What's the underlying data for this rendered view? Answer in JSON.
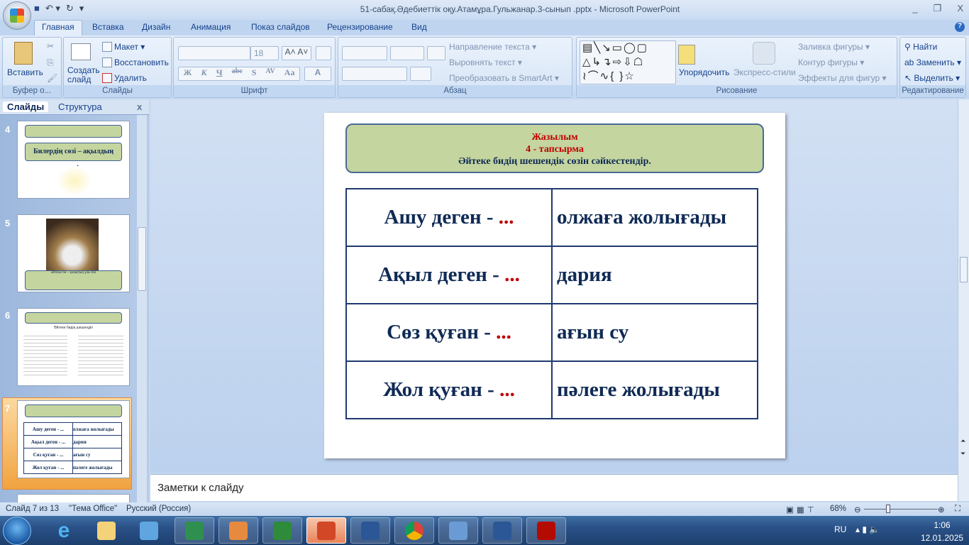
{
  "window": {
    "title": "51-сабақ.Әдебиеттік оқу.Атамұра.Гульжанар.3-сынып .pptx - Microsoft PowerPoint",
    "minimize": "_",
    "restore": "❐",
    "close": "X",
    "help": "?"
  },
  "tabs": [
    "Главная",
    "Вставка",
    "Дизайн",
    "Анимация",
    "Показ слайдов",
    "Рецензирование",
    "Вид"
  ],
  "ribbon": {
    "clipboard": {
      "label": "Буфер о...",
      "paste": "Вставить"
    },
    "slides": {
      "label": "Слайды",
      "new_slide": "Создать слайд",
      "layout": "Макет",
      "reset": "Восстановить",
      "delete": "Удалить"
    },
    "font": {
      "label": "Шрифт",
      "size": "18",
      "bold": "Ж",
      "italic": "К",
      "underline": "Ч",
      "strike": "abc",
      "shadow": "S",
      "spacing": "AV",
      "case": "Aa",
      "color": "A"
    },
    "paragraph": {
      "label": "Абзац",
      "direction": "Направление текста",
      "align": "Выровнять текст",
      "smartart": "Преобразовать в SmartArt"
    },
    "drawing": {
      "label": "Рисование",
      "arrange": "Упорядочить",
      "quick_styles": "Экспресс-стили",
      "fill": "Заливка фигуры",
      "outline": "Контур фигуры",
      "effects": "Эффекты для фигур"
    },
    "editing": {
      "label": "Редактирование",
      "find": "Найти",
      "replace": "Заменить",
      "select": "Выделить"
    }
  },
  "left_pane": {
    "tabs": [
      "Слайды",
      "Структура"
    ],
    "close": "x",
    "thumbs": [
      {
        "num": "4",
        "title": "Билердің сөзі – ақылдың көзі."
      },
      {
        "num": "5",
        "caption": "Әйтеке би – қазақтың ұлы биі"
      },
      {
        "num": "6",
        "caption": "Әйтеке бидің шешендігі"
      },
      {
        "num": "7",
        "rows": [
          [
            "Ашу деген - ...",
            "олжаға жолығады"
          ],
          [
            "Ақыл деген - ...",
            "дария"
          ],
          [
            "Сөз қуған - ...",
            "ағын су"
          ],
          [
            "Жол қуған - ...",
            "пәлеге жолығады"
          ]
        ]
      }
    ]
  },
  "slide": {
    "heading1": "Жазылым",
    "heading2": "4 - тапсырма",
    "instruction": "Әйтеке бидің шешендік  сөзін  сәйкестендір.",
    "table": [
      {
        "left": "Ашу деген - ",
        "dots": "...",
        "right": "олжаға жолығады"
      },
      {
        "left": "Ақыл деген - ",
        "dots": "...",
        "right": "дария"
      },
      {
        "left": "Сөз қуған - ",
        "dots": "...",
        "right": "ағын су"
      },
      {
        "left": "Жол қуған - ",
        "dots": "...",
        "right": "пәлеге жолығады"
      }
    ]
  },
  "notes_placeholder": "Заметки к слайду",
  "status": {
    "slide": "Слайд 7 из 13",
    "theme": "\"Тема Office\"",
    "lang": "Русский (Россия)",
    "zoom": "68%",
    "zoom_value": 68
  },
  "tray": {
    "lang": "RU",
    "time": "1:06",
    "date": "12.01.2025"
  }
}
